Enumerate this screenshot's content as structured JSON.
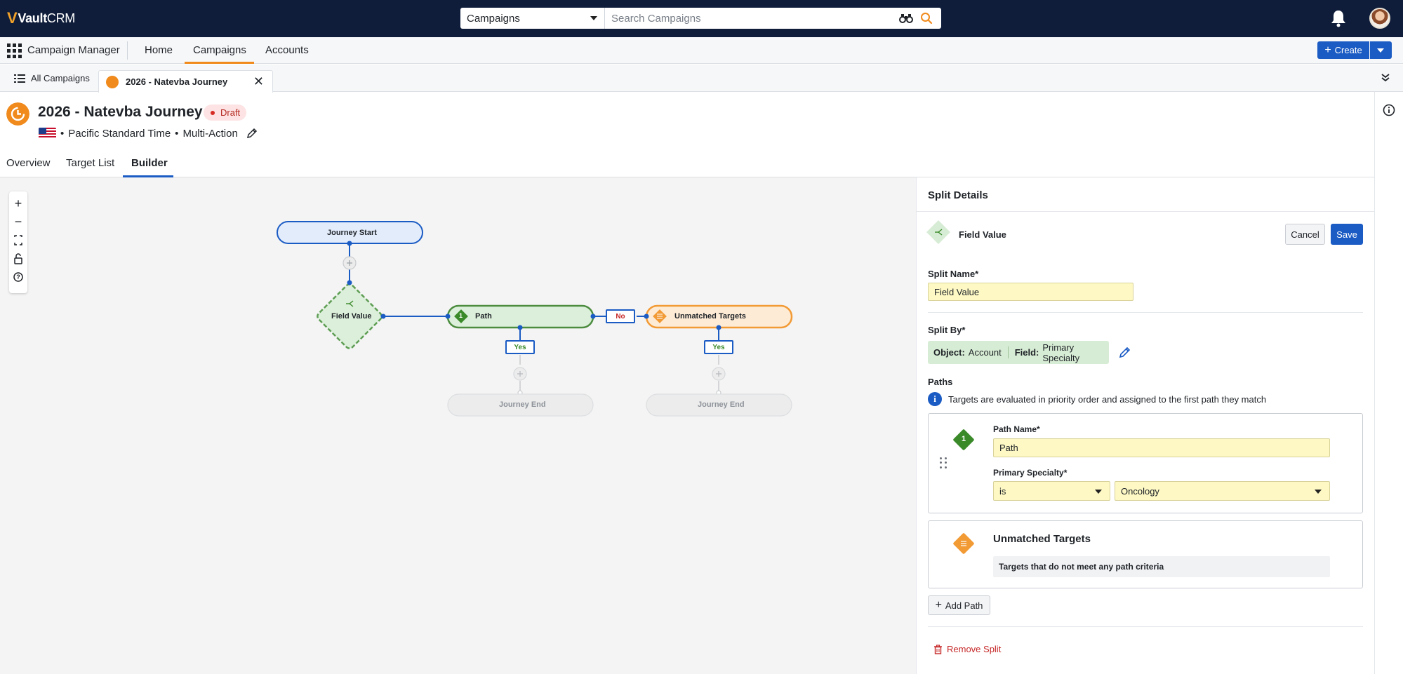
{
  "topbar": {
    "logo_text_vault": "Vault",
    "logo_text_crm": "CRM",
    "search_scope": "Campaigns",
    "search_placeholder": "Search Campaigns"
  },
  "navbar": {
    "app_name": "Campaign Manager",
    "tabs": [
      "Home",
      "Campaigns",
      "Accounts"
    ],
    "active_tab": "Campaigns",
    "create_label": "Create"
  },
  "tabstrip": {
    "all_label": "All Campaigns",
    "current_label": "2026 - Natevba Journey"
  },
  "record": {
    "title": "2026 - Natevba Journey",
    "status": "Draft",
    "timezone": "Pacific Standard Time",
    "type": "Multi-Action",
    "separator": "•"
  },
  "page_tabs": [
    "Overview",
    "Target List",
    "Builder"
  ],
  "active_page_tab": "Builder",
  "flow": {
    "start": "Journey Start",
    "split": "Field Value",
    "path": "Path",
    "path_number": "1",
    "unmatched": "Unmatched Targets",
    "end": "Journey End",
    "yes": "Yes",
    "no": "No"
  },
  "panel": {
    "title": "Split Details",
    "split_type": "Field Value",
    "cancel": "Cancel",
    "save": "Save",
    "split_name_label": "Split Name*",
    "split_name_value": "Field Value",
    "split_by_label": "Split By*",
    "object_key": "Object:",
    "object_value": "Account",
    "field_key": "Field:",
    "field_value": "Primary Specialty",
    "paths_label": "Paths",
    "paths_hint": "Targets are evaluated in priority order and assigned to the first path they match",
    "path_number": "1",
    "path_name_label": "Path Name*",
    "path_name_value": "Path",
    "criteria_label": "Primary Specialty*",
    "operator": "is",
    "criteria_value": "Oncology",
    "unmatched_title": "Unmatched Targets",
    "unmatched_desc": "Targets that do not meet any path criteria",
    "add_path": "Add Path",
    "remove_split": "Remove Split"
  },
  "colors": {
    "topbar": "#0f1d3a",
    "accent_orange": "#f08a1c",
    "primary_blue": "#1a5bc4",
    "required_yellow": "#fdf8c4",
    "path_green": "#3a8a2a"
  }
}
